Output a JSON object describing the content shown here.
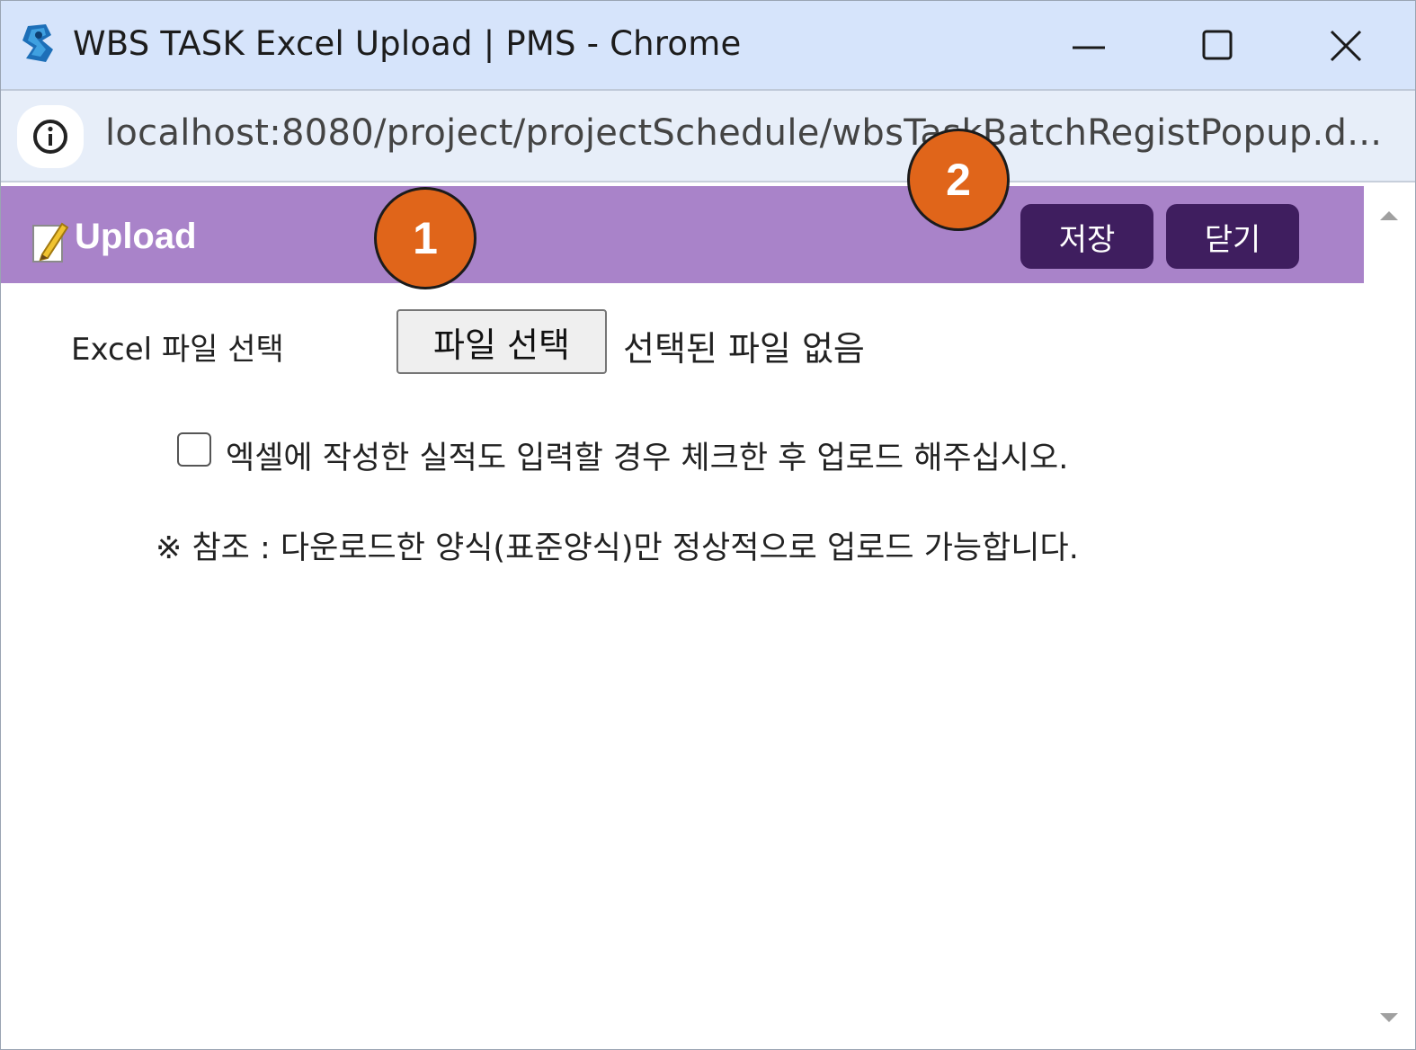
{
  "window": {
    "title": "WBS TASK Excel Upload | PMS - Chrome",
    "url": "localhost:8080/project/projectSchedule/wbsTaskBatchRegistPopup.d..."
  },
  "header": {
    "title": "Upload",
    "save_label": "저장",
    "close_label": "닫기",
    "background_color": "#a983c9",
    "button_color": "#3f1e5f"
  },
  "form": {
    "excel_label": "Excel 파일 선택",
    "file_button_label": "파일 선택",
    "file_status": "선택된 파일 없음",
    "checkbox_label": "엑셀에 작성한 실적도 입력할 경우 체크한 후 업로드 해주십시오.",
    "checkbox_checked": false,
    "note": "※ 참조 : 다운로드한 양식(표준양식)만 정상적으로 업로드 가능합니다."
  },
  "markers": [
    {
      "label": "1"
    },
    {
      "label": "2"
    }
  ],
  "marker_color": "#e0651a",
  "icons": {
    "app": "app-logo-icon",
    "info": "info-icon",
    "header": "edit-document-icon"
  }
}
